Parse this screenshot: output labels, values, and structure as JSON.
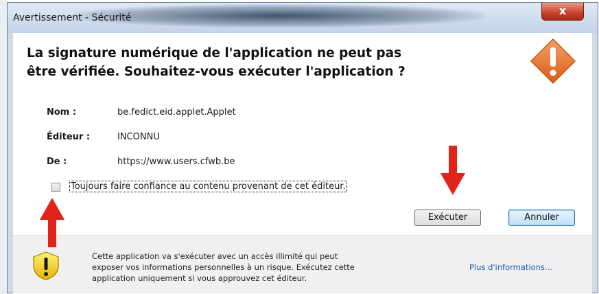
{
  "window": {
    "title": "Avertissement - Sécurité",
    "close_label": "x"
  },
  "header": {
    "line1": "La signature numérique de l'application ne peut pas",
    "line2": "être vérifiée.  Souhaitez-vous exécuter l'application ?",
    "icon": "warning-diamond-icon"
  },
  "details": {
    "name_label": "Nom :",
    "name_value": "be.fedict.eid.applet.Applet",
    "publisher_label": "Éditeur :",
    "publisher_value": "INCONNU",
    "from_label": "De :",
    "from_value": "https://www.users.cfwb.be"
  },
  "trust_checkbox": {
    "label": "Toujours faire confiance au contenu provenant de cet éditeur.",
    "checked": false
  },
  "buttons": {
    "run": "Exécuter",
    "cancel": "Annuler"
  },
  "footer": {
    "line1": "Cette application va s'exécuter avec un accès illimité qui peut",
    "line2": "exposer vos informations personnelles à un risque. Exécutez cette",
    "line3": "application uniquement si vous approuvez cet éditeur.",
    "more_info": "Plus d'informations...",
    "icon": "warning-shield-icon"
  },
  "colors": {
    "accent_red": "#e2231a",
    "warning_orange": "#e8742c",
    "link_blue": "#1e5ba8"
  }
}
